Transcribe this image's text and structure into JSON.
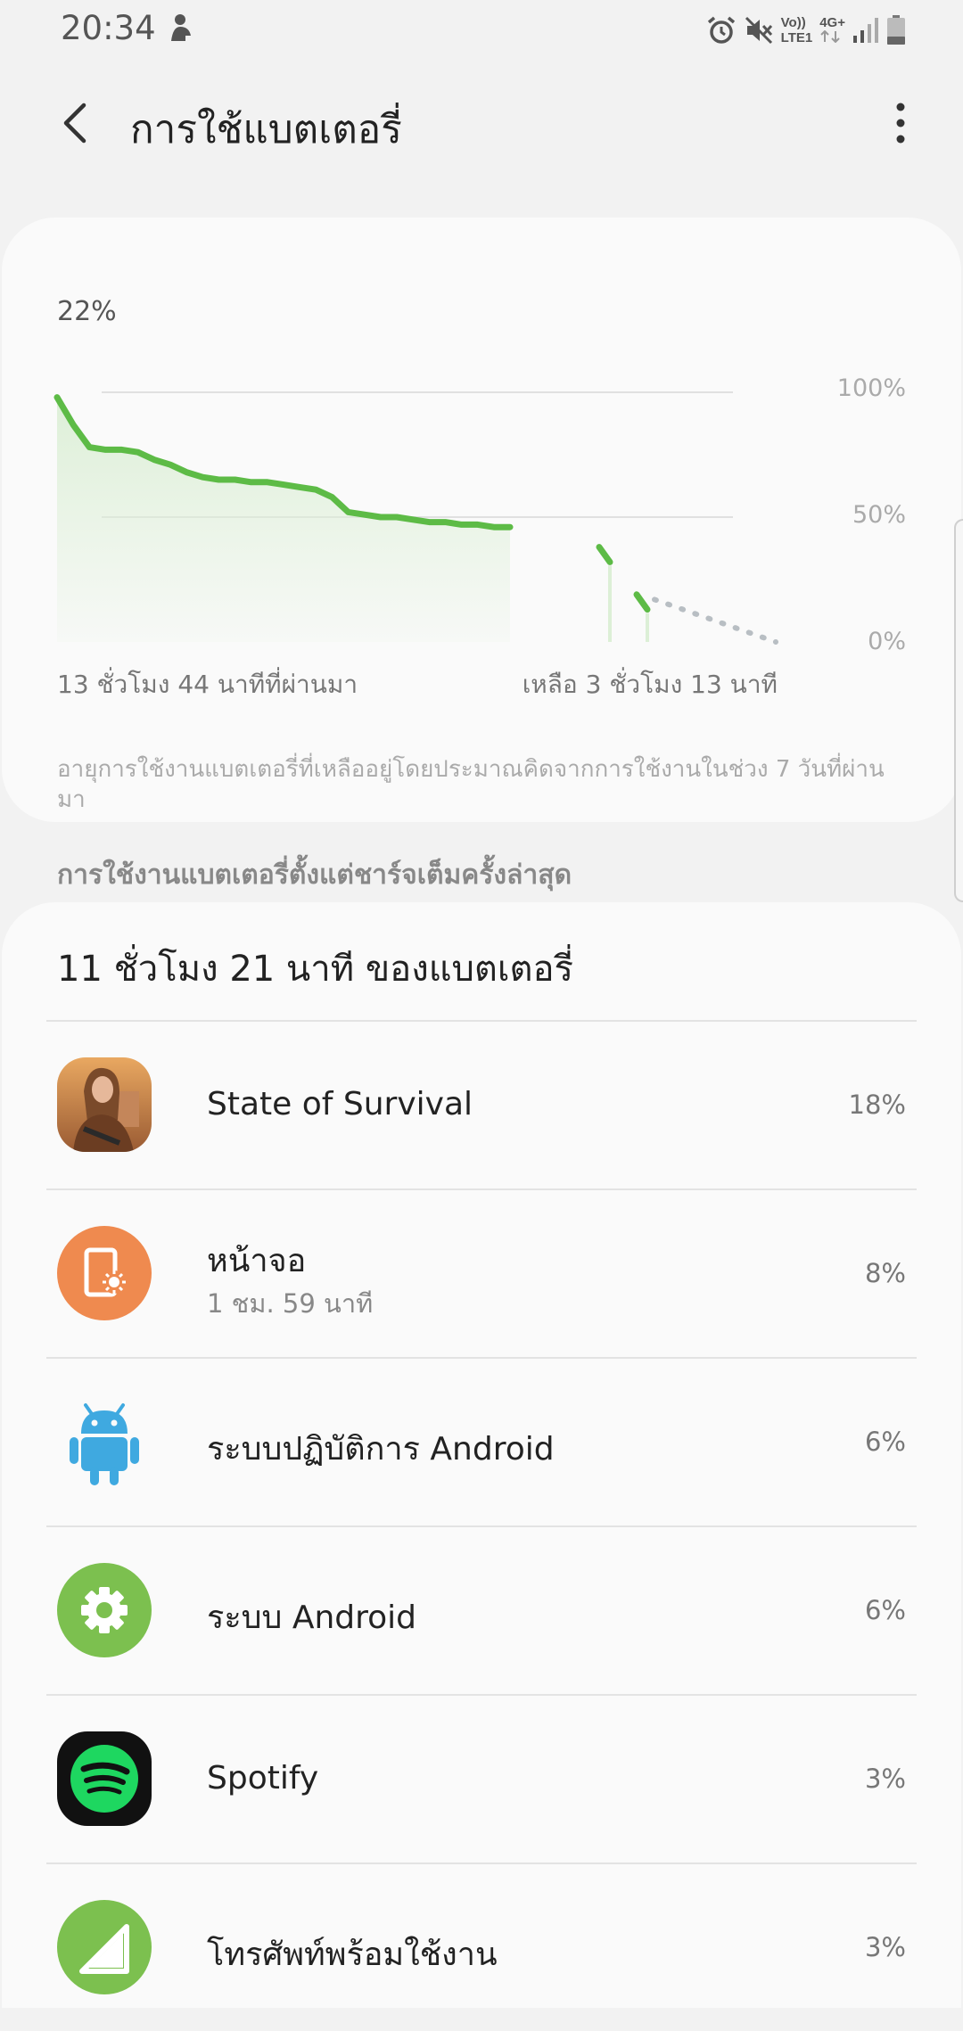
{
  "status_bar": {
    "time": "20:34",
    "volte": "Vo))",
    "lte": "LTE1",
    "network": "4G+"
  },
  "header": {
    "title": "การใช้แบตเตอรี่"
  },
  "chart_data": {
    "type": "line",
    "current_level": "22%",
    "y_ticks": [
      "100%",
      "50%",
      "0%"
    ],
    "ylim": [
      0,
      100
    ],
    "x_start_label": "13 ชั่วโมง 44 นาทีที่ผ่านมา",
    "x_end_label": "เหลือ 3 ชั่วโมง 13 นาที",
    "grid": true,
    "series": [
      {
        "values": [
          98,
          87,
          78,
          77,
          77,
          76,
          73,
          71,
          68,
          66,
          65,
          65,
          64,
          64,
          63,
          62,
          61,
          58,
          52,
          51,
          50,
          50,
          49,
          48,
          48,
          47,
          47,
          46,
          46
        ]
      },
      {
        "values": [
          38,
          32
        ]
      },
      {
        "values": [
          19,
          13
        ]
      }
    ],
    "projection": {
      "values": [
        17,
        0
      ]
    },
    "colors": {
      "line": "#5dbb46",
      "projection": "#b8bec3",
      "fill": "#dcefd6"
    }
  },
  "chart_note": "อายุการใช้งานแบตเตอรี่ที่เหลืออยู่โดยประมาณคิดจากการใช้งานในช่วง 7 วันที่ผ่านมา",
  "section_header": "การใช้งานแบตเตอรี่ตั้งแต่ชาร์จเต็มครั้งล่าสุด",
  "usage": {
    "total": "11 ชั่วโมง 21 นาที ของแบตเตอรี่",
    "apps": [
      {
        "name": "State of Survival",
        "sub": "",
        "percent": "18%",
        "icon": "state-of-survival-icon"
      },
      {
        "name": "หน้าจอ",
        "sub": "1 ชม. 59 นาที",
        "percent": "8%",
        "icon": "screen-icon"
      },
      {
        "name": "ระบบปฏิบัติการ Android",
        "sub": "",
        "percent": "6%",
        "icon": "android-robot-icon"
      },
      {
        "name": "ระบบ Android",
        "sub": "",
        "percent": "6%",
        "icon": "android-system-gear-icon"
      },
      {
        "name": "Spotify",
        "sub": "",
        "percent": "3%",
        "icon": "spotify-icon"
      },
      {
        "name": "โทรศัพท์พร้อมใช้งาน",
        "sub": "",
        "percent": "3%",
        "icon": "phone-idle-icon"
      }
    ]
  }
}
